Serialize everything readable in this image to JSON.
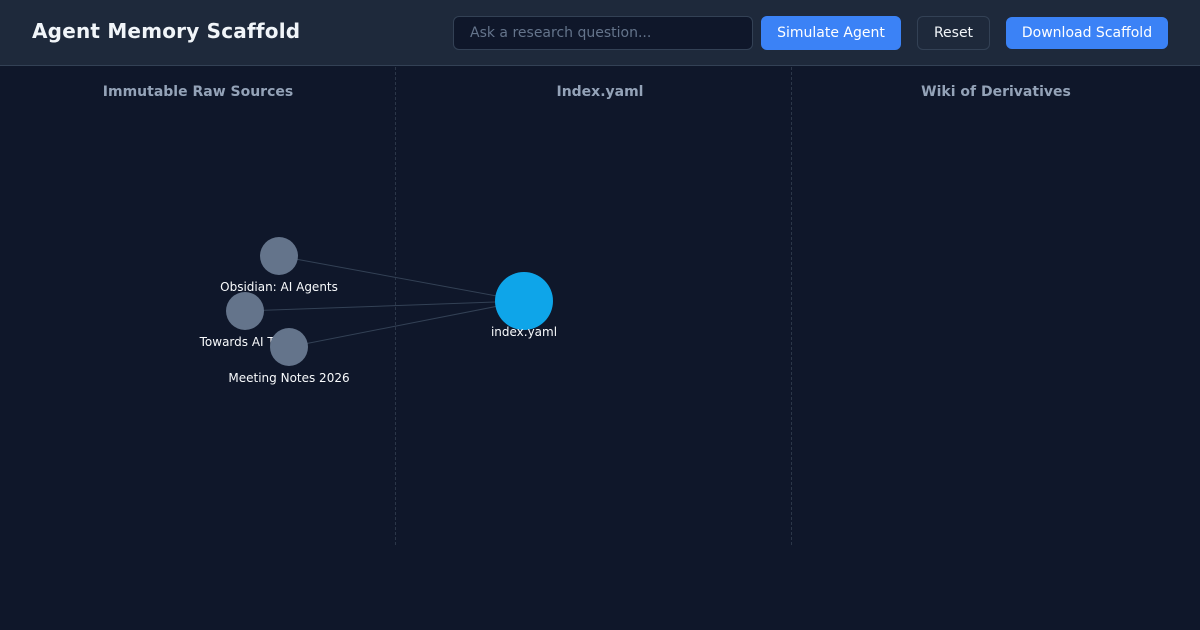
{
  "header": {
    "title": "Agent Memory Scaffold",
    "search_placeholder": "Ask a research question...",
    "simulate_label": "Simulate Agent",
    "reset_label": "Reset",
    "download_label": "Download Scaffold"
  },
  "columns": [
    {
      "title": "Immutable Raw Sources"
    },
    {
      "title": "Index.yaml"
    },
    {
      "title": "Wiki of Derivatives"
    }
  ],
  "graph": {
    "nodes": [
      {
        "id": "src1",
        "label": "Obsidian: AI Agents",
        "kind": "source"
      },
      {
        "id": "src2",
        "label": "Towards AI Talk",
        "kind": "source"
      },
      {
        "id": "src3",
        "label": "Meeting Notes 2026",
        "kind": "source"
      },
      {
        "id": "index",
        "label": "index.yaml",
        "kind": "index"
      }
    ],
    "edges": [
      {
        "from": "src1",
        "to": "index"
      },
      {
        "from": "src2",
        "to": "index"
      },
      {
        "from": "src3",
        "to": "index"
      }
    ]
  },
  "colors": {
    "source_node": "#64748b",
    "index_node": "#0ea5e9",
    "edge": "#334155",
    "accent": "#3b82f6"
  }
}
